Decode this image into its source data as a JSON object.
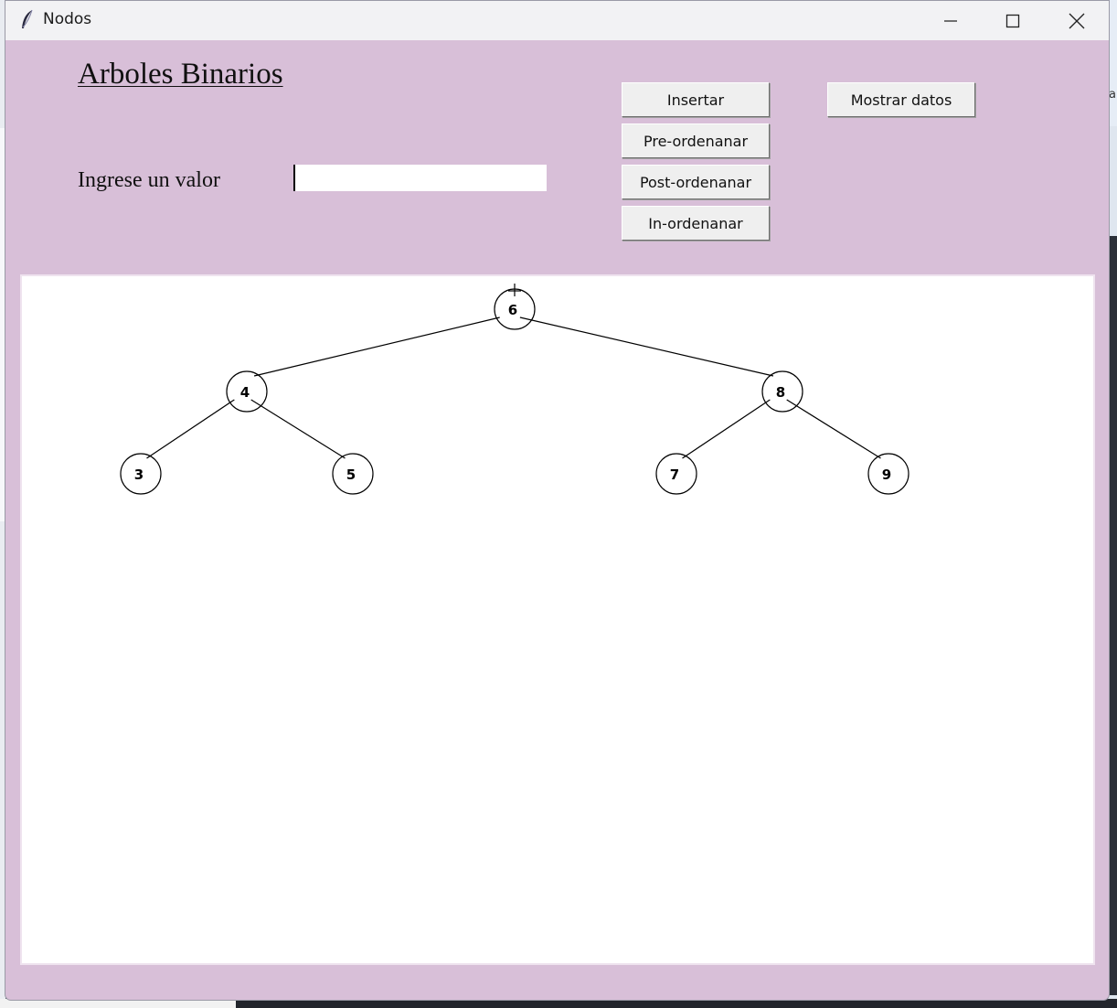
{
  "window": {
    "title": "Nodos"
  },
  "desktop": {
    "right_edge_text": "a"
  },
  "form": {
    "heading": "Arboles Binarios",
    "prompt_label": "Ingrese un valor",
    "input_value": ""
  },
  "buttons": {
    "insert": "Insertar",
    "preorder": "Pre-ordenanar",
    "postorder": "Post-ordenanar",
    "inorder": "In-ordenanar",
    "show_data": "Mostrar datos"
  },
  "tree": {
    "nodes": [
      {
        "id": "n6",
        "label": "6",
        "depth": 0,
        "parent": null,
        "side": null
      },
      {
        "id": "n4",
        "label": "4",
        "depth": 1,
        "parent": "n6",
        "side": "left"
      },
      {
        "id": "n8",
        "label": "8",
        "depth": 1,
        "parent": "n6",
        "side": "right"
      },
      {
        "id": "n3",
        "label": "3",
        "depth": 2,
        "parent": "n4",
        "side": "left"
      },
      {
        "id": "n5",
        "label": "5",
        "depth": 2,
        "parent": "n4",
        "side": "right"
      },
      {
        "id": "n7",
        "label": "7",
        "depth": 2,
        "parent": "n8",
        "side": "left"
      },
      {
        "id": "n9",
        "label": "9",
        "depth": 2,
        "parent": "n8",
        "side": "right"
      }
    ]
  },
  "colors": {
    "window_bg": "#d8bfd8",
    "canvas_bg": "#ffffff",
    "node_stroke": "#000000"
  }
}
